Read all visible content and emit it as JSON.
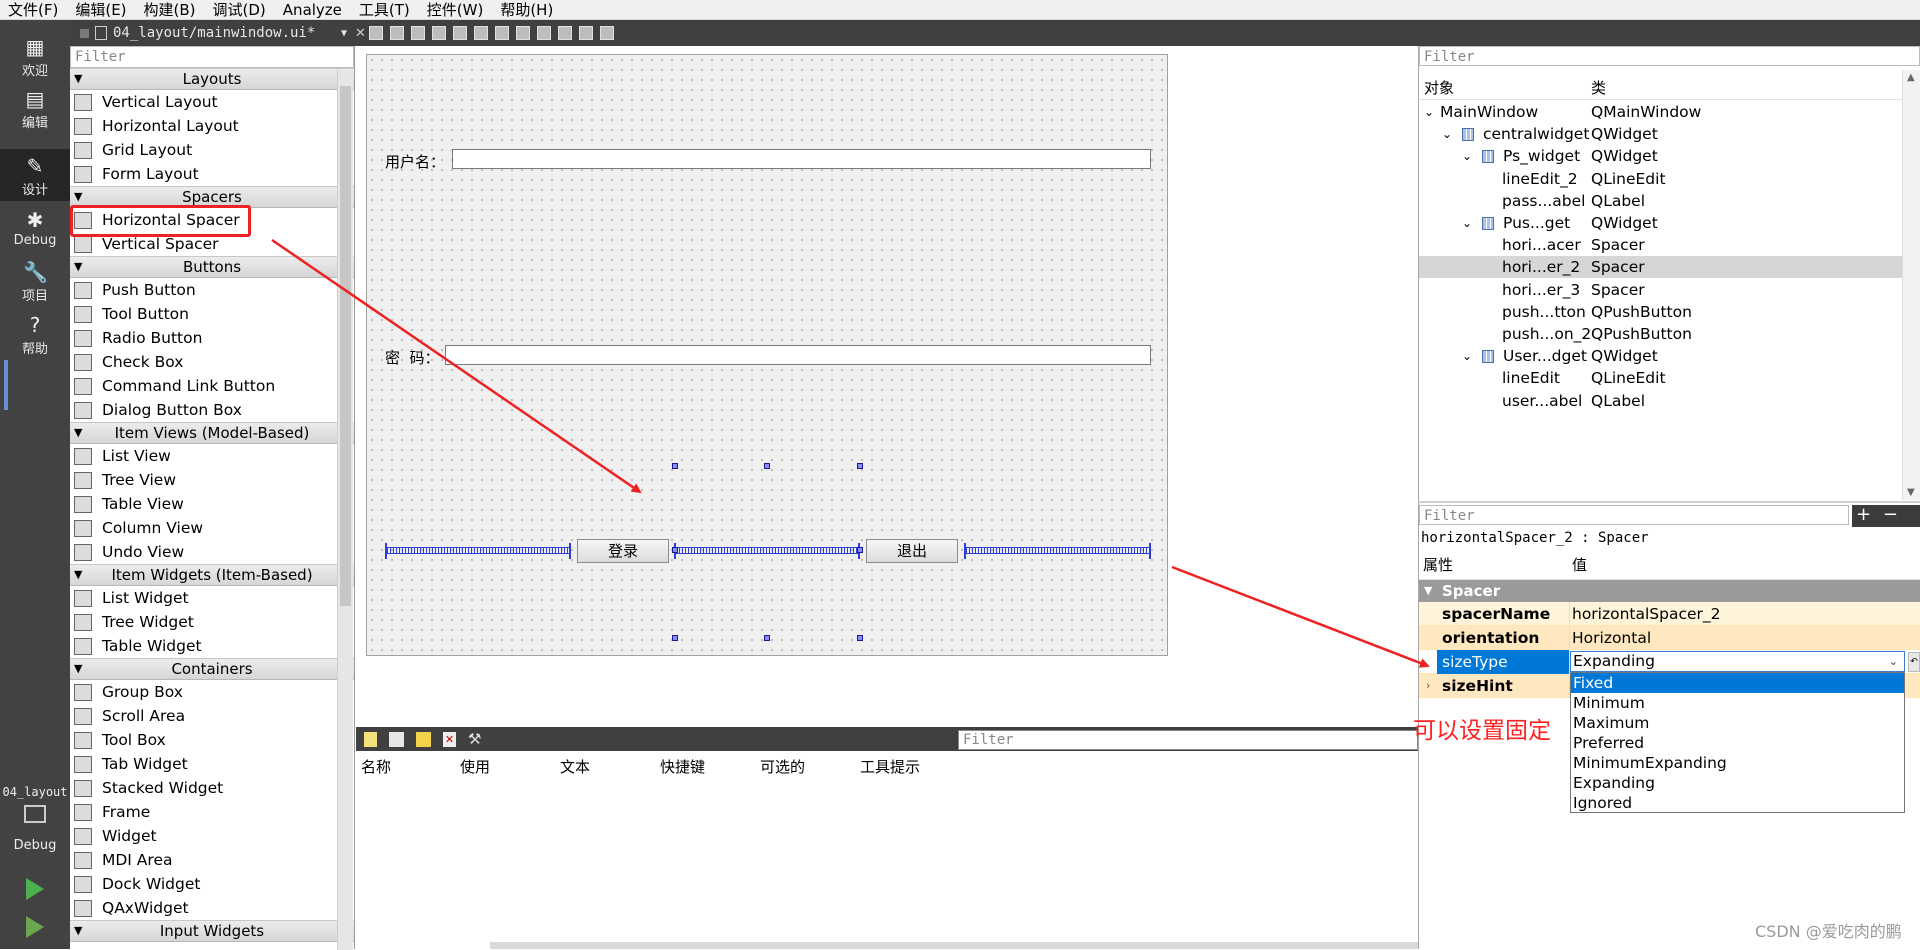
{
  "menu": [
    "文件(F)",
    "编辑(E)",
    "构建(B)",
    "调试(D)",
    "Analyze",
    "工具(T)",
    "控件(W)",
    "帮助(H)"
  ],
  "modes": [
    {
      "label": "欢迎",
      "icon": "grid-icon"
    },
    {
      "label": "编辑",
      "icon": "edit-icon"
    },
    {
      "label": "设计",
      "icon": "pencil-icon"
    },
    {
      "label": "Debug",
      "icon": "bug-icon"
    },
    {
      "label": "项目",
      "icon": "wrench-icon"
    },
    {
      "label": "帮助",
      "icon": "help-icon"
    }
  ],
  "build": {
    "project": "04_layout",
    "target": "Debug"
  },
  "editor": {
    "file_tab": "04_layout/mainwindow.ui*"
  },
  "widgetbox": {
    "filter_placeholder": "Filter",
    "categories": [
      {
        "title": "Layouts",
        "items": [
          "Vertical Layout",
          "Horizontal Layout",
          "Grid Layout",
          "Form Layout"
        ]
      },
      {
        "title": "Spacers",
        "items": [
          "Horizontal Spacer",
          "Vertical Spacer"
        ]
      },
      {
        "title": "Buttons",
        "items": [
          "Push Button",
          "Tool Button",
          "Radio Button",
          "Check Box",
          "Command Link Button",
          "Dialog Button Box"
        ]
      },
      {
        "title": "Item Views (Model-Based)",
        "items": [
          "List View",
          "Tree View",
          "Table View",
          "Column View",
          "Undo View"
        ]
      },
      {
        "title": "Item Widgets (Item-Based)",
        "items": [
          "List Widget",
          "Tree Widget",
          "Table Widget"
        ]
      },
      {
        "title": "Containers",
        "items": [
          "Group Box",
          "Scroll Area",
          "Tool Box",
          "Tab Widget",
          "Stacked Widget",
          "Frame",
          "Widget",
          "MDI Area",
          "Dock Widget",
          "QAxWidget"
        ]
      },
      {
        "title": "Input Widgets",
        "items": []
      }
    ]
  },
  "form": {
    "username_label": "用户名：",
    "password_label": "密  码：",
    "login_button": "登录",
    "exit_button": "退出"
  },
  "action_editor": {
    "filter_placeholder": "Filter",
    "columns": [
      "名称",
      "使用",
      "文本",
      "快捷键",
      "可选的",
      "工具提示"
    ]
  },
  "object_inspector": {
    "filter_placeholder": "Filter",
    "col_object": "对象",
    "col_class": "类",
    "rows": [
      {
        "name": "MainWindow",
        "class": "QMainWindow",
        "depth": 0,
        "expand": "open",
        "layout_icon": false
      },
      {
        "name": "centralwidget",
        "class": "QWidget",
        "depth": 1,
        "expand": "open",
        "layout_icon": true
      },
      {
        "name": "Ps_widget",
        "class": "QWidget",
        "depth": 2,
        "expand": "open",
        "layout_icon": true
      },
      {
        "name": "lineEdit_2",
        "class": "QLineEdit",
        "depth": 3,
        "expand": "",
        "layout_icon": false
      },
      {
        "name": "pass...abel",
        "class": "QLabel",
        "depth": 3,
        "expand": "",
        "layout_icon": false
      },
      {
        "name": "Pus...get",
        "class": "QWidget",
        "depth": 2,
        "expand": "open",
        "layout_icon": true
      },
      {
        "name": "hori...acer",
        "class": "Spacer",
        "depth": 3,
        "expand": "",
        "layout_icon": false
      },
      {
        "name": "hori...er_2",
        "class": "Spacer",
        "depth": 3,
        "expand": "",
        "layout_icon": false,
        "selected": true
      },
      {
        "name": "hori...er_3",
        "class": "Spacer",
        "depth": 3,
        "expand": "",
        "layout_icon": false
      },
      {
        "name": "push...tton",
        "class": "QPushButton",
        "depth": 3,
        "expand": "",
        "layout_icon": false
      },
      {
        "name": "push...on_2",
        "class": "QPushButton",
        "depth": 3,
        "expand": "",
        "layout_icon": false
      },
      {
        "name": "User...dget",
        "class": "QWidget",
        "depth": 2,
        "expand": "open",
        "layout_icon": true
      },
      {
        "name": "lineEdit",
        "class": "QLineEdit",
        "depth": 3,
        "expand": "",
        "layout_icon": false
      },
      {
        "name": "user...abel",
        "class": "QLabel",
        "depth": 3,
        "expand": "",
        "layout_icon": false
      }
    ]
  },
  "property_editor": {
    "filter_placeholder": "Filter",
    "object_line": "horizontalSpacer_2 : Spacer",
    "col_property": "属性",
    "col_value": "值",
    "group": "Spacer",
    "props": [
      {
        "name": "spacerName",
        "value": "horizontalSpacer_2"
      },
      {
        "name": "orientation",
        "value": "Horizontal"
      },
      {
        "name": "sizeType",
        "value": "Expanding"
      },
      {
        "name": "sizeHint",
        "value": ""
      }
    ],
    "sizetype_options": [
      "Fixed",
      "Minimum",
      "Maximum",
      "Preferred",
      "MinimumExpanding",
      "Expanding",
      "Ignored"
    ],
    "highlighted_option": "Fixed"
  },
  "annotation": "可以设置固定",
  "watermark": "CSDN @爱吃肉的鹏",
  "colors": {
    "sidebar": "#424242",
    "highlight": "#0078d7",
    "annotation": "#ff2020",
    "spacer": "#2d3fd6"
  }
}
